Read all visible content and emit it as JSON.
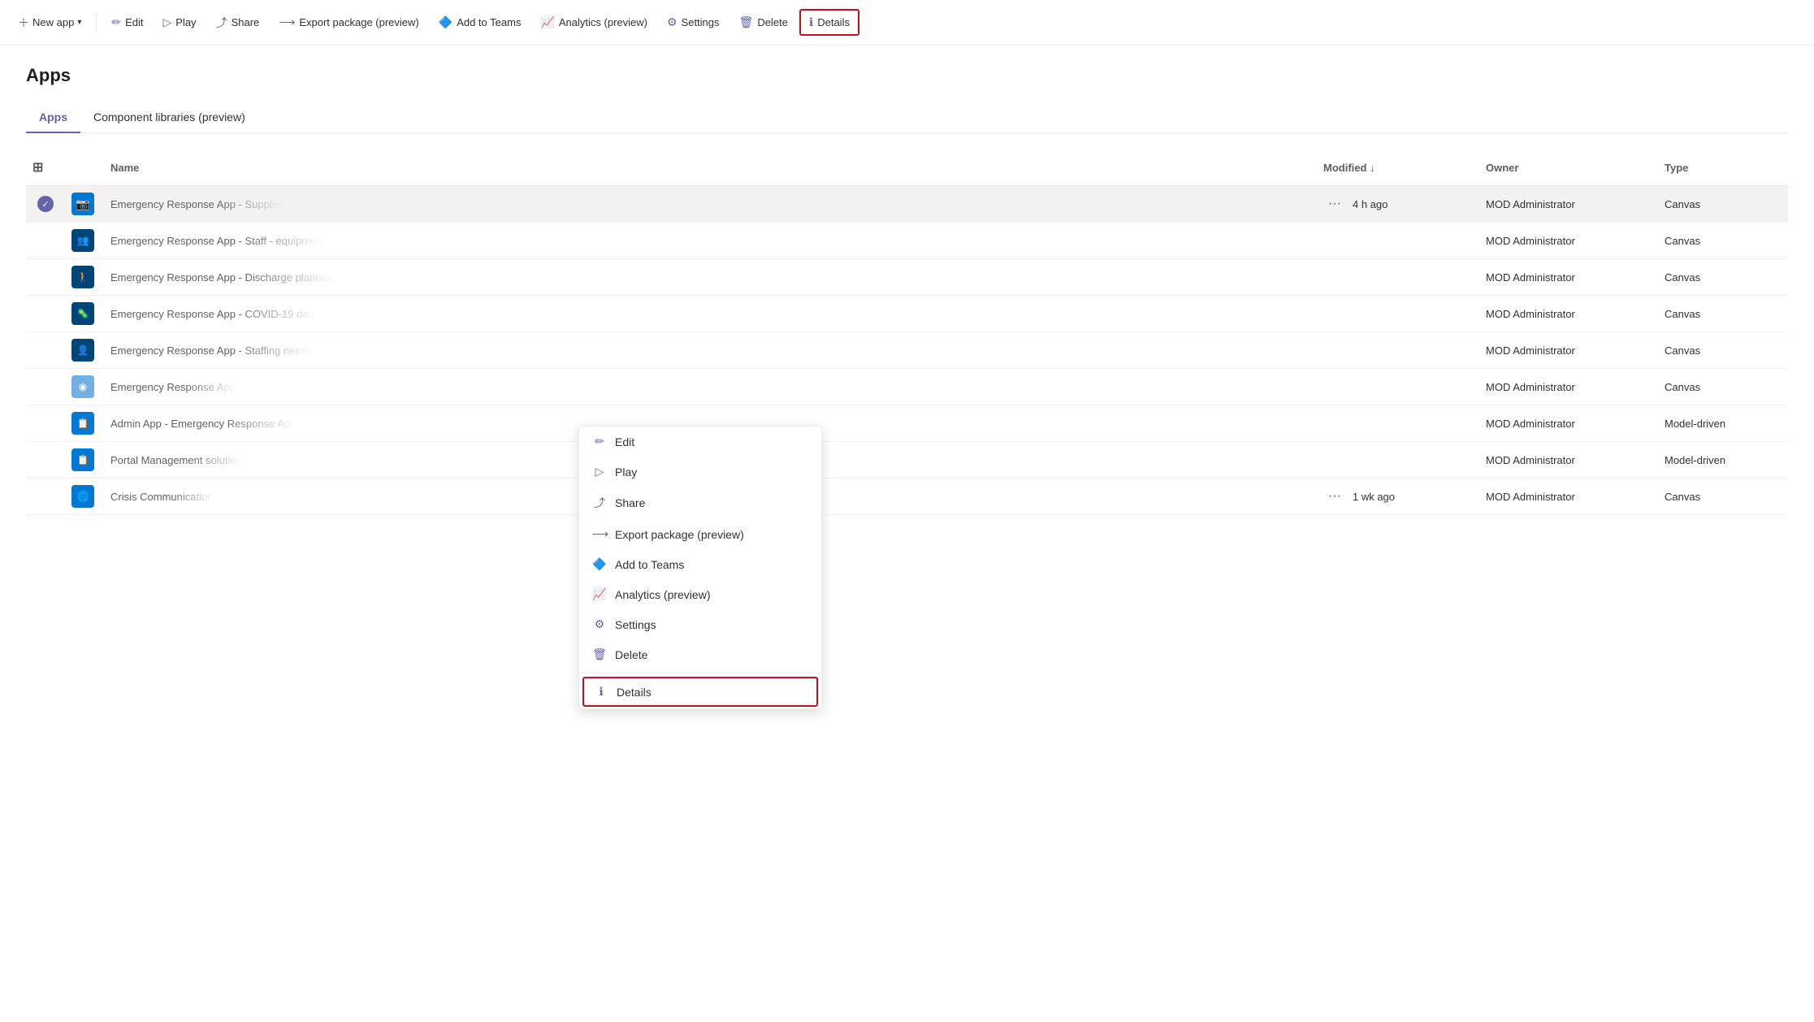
{
  "toolbar": {
    "new_app_label": "New app",
    "edit_label": "Edit",
    "play_label": "Play",
    "share_label": "Share",
    "export_label": "Export package (preview)",
    "add_to_teams_label": "Add to Teams",
    "analytics_label": "Analytics (preview)",
    "settings_label": "Settings",
    "delete_label": "Delete",
    "details_label": "Details"
  },
  "page": {
    "title": "Apps"
  },
  "tabs": [
    {
      "label": "Apps",
      "active": true
    },
    {
      "label": "Component libraries (preview)",
      "active": false
    }
  ],
  "table": {
    "columns": [
      "",
      "",
      "Name",
      "Modified ↓",
      "Owner",
      "Type"
    ],
    "rows": [
      {
        "selected": true,
        "icon": "camera",
        "iconColor": "blue",
        "name": "Emergency Response App - Supplies",
        "modified": "4 h ago",
        "owner": "MOD Administrator",
        "type": "Canvas",
        "blurred": true,
        "showDots": true
      },
      {
        "selected": false,
        "icon": "people",
        "iconColor": "blue-dark",
        "name": "Emergency Response App - Staff - equipment",
        "modified": "",
        "owner": "MOD Administrator",
        "type": "Canvas",
        "blurred": true,
        "showDots": false
      },
      {
        "selected": false,
        "icon": "person-arrow",
        "iconColor": "blue-dark",
        "name": "Emergency Response App - Discharge planning",
        "modified": "",
        "owner": "MOD Administrator",
        "type": "Canvas",
        "blurred": true,
        "showDots": false
      },
      {
        "selected": false,
        "icon": "covid",
        "iconColor": "blue-dark",
        "name": "Emergency Response App - COVID-19 data",
        "modified": "",
        "owner": "MOD Administrator",
        "type": "Canvas",
        "blurred": true,
        "showDots": false
      },
      {
        "selected": false,
        "icon": "people-alt",
        "iconColor": "blue-dark",
        "name": "Emergency Response App - Staffing needs",
        "modified": "",
        "owner": "MOD Administrator",
        "type": "Canvas",
        "blurred": true,
        "showDots": false
      },
      {
        "selected": false,
        "icon": "dot",
        "iconColor": "blue-light",
        "name": "Emergency Response App",
        "modified": "",
        "owner": "MOD Administrator",
        "type": "Canvas",
        "blurred": true,
        "showDots": false
      },
      {
        "selected": false,
        "icon": "form",
        "iconColor": "blue",
        "name": "Admin App - Emergency Response App",
        "modified": "",
        "owner": "MOD Administrator",
        "type": "Model-driven",
        "blurred": true,
        "showDots": false
      },
      {
        "selected": false,
        "icon": "form",
        "iconColor": "blue",
        "name": "Portal Management solution",
        "modified": "",
        "owner": "MOD Administrator",
        "type": "Model-driven",
        "blurred": true,
        "showDots": false
      },
      {
        "selected": false,
        "icon": "globe",
        "iconColor": "blue",
        "name": "Crisis Communication",
        "modified": "1 wk ago",
        "owner": "MOD Administrator",
        "type": "Canvas",
        "blurred": true,
        "showDots": true
      }
    ]
  },
  "contextMenu": {
    "items": [
      {
        "label": "Edit",
        "icon": "✏"
      },
      {
        "label": "Play",
        "icon": "▷"
      },
      {
        "label": "Share",
        "icon": "⤴"
      },
      {
        "label": "Export package (preview)",
        "icon": "⟶"
      },
      {
        "label": "Add to Teams",
        "icon": "🔷"
      },
      {
        "label": "Analytics (preview)",
        "icon": "📈"
      },
      {
        "label": "Settings",
        "icon": "⚙"
      },
      {
        "label": "Delete",
        "icon": "🗑"
      },
      {
        "label": "Details",
        "icon": "ℹ",
        "highlighted": true
      }
    ]
  }
}
